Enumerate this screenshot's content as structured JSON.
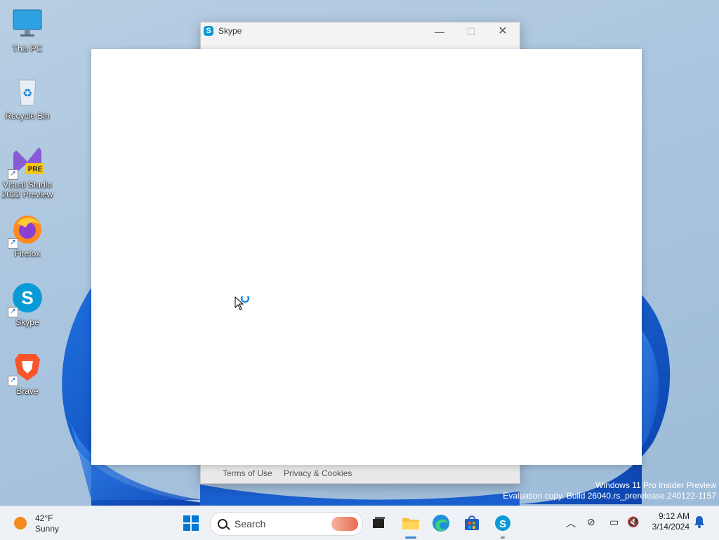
{
  "desktop": {
    "icons": [
      {
        "label": "This PC",
        "icon": "this-pc-icon"
      },
      {
        "label": "Recycle Bin",
        "icon": "recycle-bin-icon"
      },
      {
        "label": "Visual Studio 2022 Preview",
        "icon": "visual-studio-icon",
        "badge": "PRE"
      },
      {
        "label": "Firefox",
        "icon": "firefox-icon"
      },
      {
        "label": "Skype",
        "icon": "skype-icon"
      },
      {
        "label": "Brave",
        "icon": "brave-icon"
      }
    ],
    "watermark_line1": "Windows 11 Pro Insider Preview",
    "watermark_line2": "Evaluation copy. Build 26040.rs_prerelease.240122-1157"
  },
  "skype_window": {
    "title": "Skype",
    "footer_links": [
      "Terms of Use",
      "Privacy & Cookies"
    ]
  },
  "taskbar": {
    "weather_temp": "42°F",
    "weather_condition": "Sunny",
    "search_placeholder": "Search",
    "time": "9:12 AM",
    "date": "3/14/2024"
  },
  "colors": {
    "accent": "#0078d4",
    "skype_blue": "#0a9bd6",
    "taskbar_bg": "#eef2f6"
  }
}
